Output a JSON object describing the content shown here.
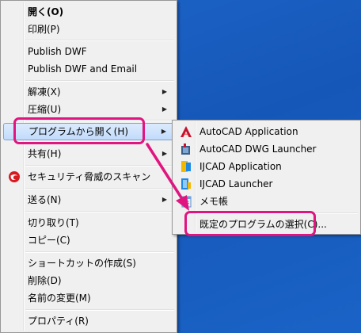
{
  "context_menu": {
    "items": [
      {
        "label": "開く(O)"
      },
      {
        "label": "印刷(P)"
      },
      {
        "label": "Publish DWF"
      },
      {
        "label": "Publish DWF and Email"
      },
      {
        "label": "解凍(X)"
      },
      {
        "label": "圧縮(U)"
      },
      {
        "label": "プログラムから開く(H)"
      },
      {
        "label": "共有(H)"
      },
      {
        "label": "セキュリティ脅威のスキャン"
      },
      {
        "label": "送る(N)"
      },
      {
        "label": "切り取り(T)"
      },
      {
        "label": "コピー(C)"
      },
      {
        "label": "ショートカットの作成(S)"
      },
      {
        "label": "削除(D)"
      },
      {
        "label": "名前の変更(M)"
      },
      {
        "label": "プロパティ(R)"
      }
    ],
    "submenu_arrow": "▶"
  },
  "open_with_submenu": {
    "items": [
      {
        "label": "AutoCAD Application",
        "icon": "autocad-icon"
      },
      {
        "label": "AutoCAD DWG Launcher",
        "icon": "dwg-launcher-icon"
      },
      {
        "label": "IJCAD Application",
        "icon": "ijcad-icon"
      },
      {
        "label": "IJCAD Launcher",
        "icon": "ijcad-launcher-icon"
      },
      {
        "label": "メモ帳",
        "icon": "notepad-icon"
      },
      {
        "label": "既定のプログラムの選択(C)..."
      }
    ]
  },
  "colors": {
    "highlight": "#e0157f",
    "desktop": "#1a5fc2",
    "menu_bg": "#f0f0f0"
  }
}
